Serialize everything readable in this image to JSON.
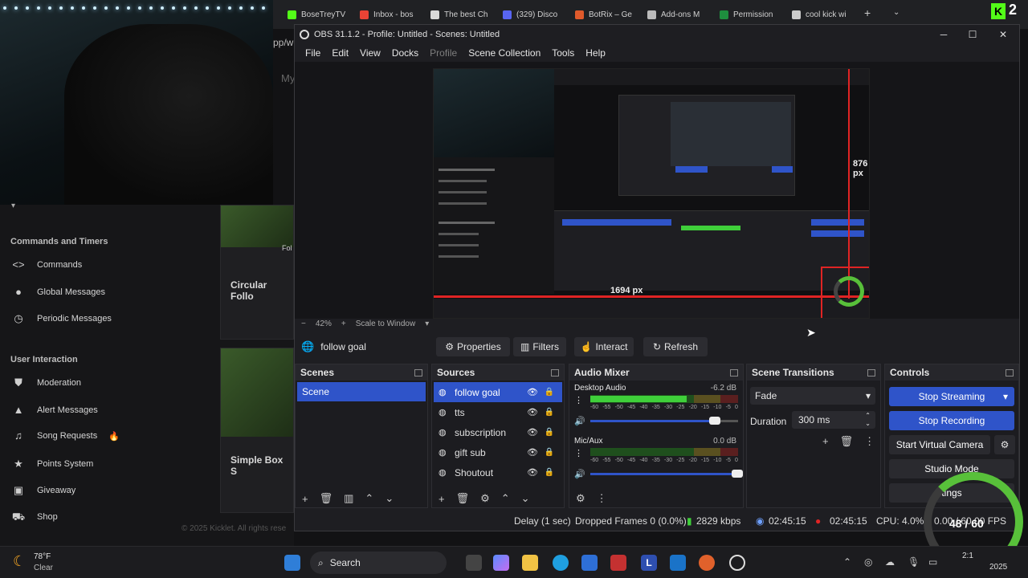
{
  "browser": {
    "tabs": [
      {
        "label": "BoseTreyTV",
        "color": "#53fc18"
      },
      {
        "label": "Inbox - bos",
        "color": "#ea4335"
      },
      {
        "label": "The best Ch",
        "color": "#d9d9d9"
      },
      {
        "label": "(329) Disco",
        "color": "#5865f2"
      },
      {
        "label": "BotRix – Ge",
        "color": "#e05a2b"
      },
      {
        "label": "Add-ons M",
        "color": "#bbbbbb"
      },
      {
        "label": "Permission",
        "color": "#1e8e3e"
      },
      {
        "label": "cool kick wi",
        "color": "#cccccc"
      }
    ],
    "new_tab": "+",
    "notification_count": "2",
    "kick_logo": "K",
    "hidden_url": "pp/w",
    "hidden_text": "My"
  },
  "site": {
    "sections": [
      {
        "title": "Commands and Timers",
        "items": [
          {
            "label": "Commands",
            "icon": "code-icon"
          },
          {
            "label": "Global Messages",
            "icon": "chat-icon"
          },
          {
            "label": "Periodic Messages",
            "icon": "clock-icon"
          }
        ]
      },
      {
        "title": "User Interaction",
        "items": [
          {
            "label": "Moderation",
            "icon": "shield-icon"
          },
          {
            "label": "Alert Messages",
            "icon": "warning-icon"
          },
          {
            "label": "Song Requests",
            "icon": "music-icon",
            "badge": "🔥"
          },
          {
            "label": "Points System",
            "icon": "star-icon"
          },
          {
            "label": "Giveaway",
            "icon": "gift-icon"
          },
          {
            "label": "Shop",
            "icon": "cart-icon"
          }
        ]
      }
    ],
    "cards": [
      {
        "title": "Circular Follo",
        "caption": "Fol"
      },
      {
        "title": "Simple Box S",
        "caption": ""
      }
    ],
    "copyright": "© 2025 Kicklet. All rights rese"
  },
  "obs": {
    "title": "OBS 31.1.2 - Profile: Untitled - Scenes: Untitled",
    "menu": [
      "File",
      "Edit",
      "View",
      "Docks",
      "Profile",
      "Scene Collection",
      "Tools",
      "Help"
    ],
    "preview_labels": {
      "height": "876 px",
      "width": "1694 px"
    },
    "zoom": {
      "minus": "−",
      "value": "42%",
      "plus": "+",
      "mode": "Scale to Window"
    },
    "current_source": "follow goal",
    "toolbar": {
      "properties": "Properties",
      "filters": "Filters",
      "interact": "Interact",
      "refresh": "Refresh"
    },
    "scenes": {
      "title": "Scenes",
      "items": [
        "Scene"
      ]
    },
    "sources": {
      "title": "Sources",
      "items": [
        "follow goal",
        "tts",
        "subscription",
        "gift sub",
        "Shoutout"
      ]
    },
    "mixer": {
      "title": "Audio Mixer",
      "channels": [
        {
          "name": "Desktop Audio",
          "db": "-6.2 dB",
          "level": 0.65,
          "volume": 0.85
        },
        {
          "name": "Mic/Aux",
          "db": "0.0 dB",
          "level": 0.0,
          "volume": 1.0
        }
      ],
      "ticks": [
        "-60",
        "-55",
        "-50",
        "-45",
        "-40",
        "-35",
        "-30",
        "-25",
        "-20",
        "-15",
        "-10",
        "-5",
        "0"
      ]
    },
    "transitions": {
      "title": "Scene Transitions",
      "type": "Fade",
      "duration_label": "Duration",
      "duration": "300 ms"
    },
    "controls": {
      "title": "Controls",
      "stop_streaming": "Stop Streaming",
      "stop_recording": "Stop Recording",
      "virtual_camera": "Start Virtual Camera",
      "studio_mode": "Studio Mode",
      "settings": "tings",
      "exit": "0.00"
    },
    "status": {
      "delay": "Delay (1 sec)",
      "dropped": "Dropped Frames 0 (0.0%)",
      "bitrate": "2829 kbps",
      "stream_time": "02:45:15",
      "rec_time": "02:45:15",
      "cpu": "CPU: 4.0%",
      "fps": "0.00 / 60.00 FPS"
    },
    "colors": {
      "accent": "#2f54c9",
      "meter_green": "#3fcf3a",
      "meter_yellow": "#c8b21f",
      "meter_red": "#c43131"
    }
  },
  "overlay": {
    "goal": "48 / 60"
  },
  "taskbar": {
    "weather_temp": "78°F",
    "weather_desc": "Clear",
    "search": "Search",
    "time": "2:1",
    "date": "2025"
  }
}
